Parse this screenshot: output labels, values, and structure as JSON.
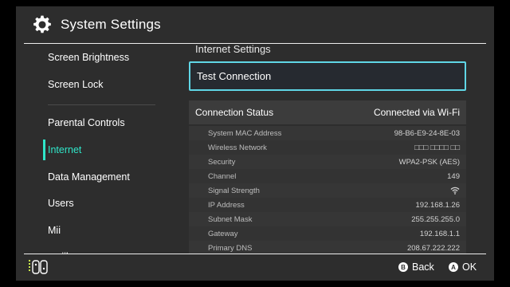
{
  "header": {
    "title": "System Settings",
    "icon": "gear-icon"
  },
  "sidebar": {
    "items": [
      {
        "label": "Screen Brightness"
      },
      {
        "label": "Screen Lock"
      },
      {
        "label": "Parental Controls"
      },
      {
        "label": "Internet"
      },
      {
        "label": "Data Management"
      },
      {
        "label": "Users"
      },
      {
        "label": "Mii"
      },
      {
        "label": "amiibo"
      }
    ],
    "active_index": 3
  },
  "main": {
    "section_title": "Internet Settings",
    "test_button": "Test Connection",
    "status": {
      "label": "Connection Status",
      "value": "Connected via Wi-Fi",
      "rows": [
        {
          "label": "System MAC Address",
          "value": "98-B6-E9-24-8E-03"
        },
        {
          "label": "Wireless Network",
          "value": "□□□ □□□□ □□"
        },
        {
          "label": "Security",
          "value": "WPA2-PSK (AES)"
        },
        {
          "label": "Channel",
          "value": "149"
        },
        {
          "label": "Signal Strength",
          "value": "",
          "icon": "wifi-signal-icon"
        },
        {
          "label": "IP Address",
          "value": "192.168.1.26"
        },
        {
          "label": "Subnet Mask",
          "value": "255.255.255.0"
        },
        {
          "label": "Gateway",
          "value": "192.168.1.1"
        },
        {
          "label": "Primary DNS",
          "value": "208.67.222.222"
        }
      ]
    }
  },
  "footer": {
    "back": {
      "key": "B",
      "label": "Back"
    },
    "ok": {
      "key": "A",
      "label": "OK"
    }
  },
  "colors": {
    "accent": "#2fe6c9",
    "focus_border": "#5fd6e6",
    "background": "#2d2d2d"
  }
}
